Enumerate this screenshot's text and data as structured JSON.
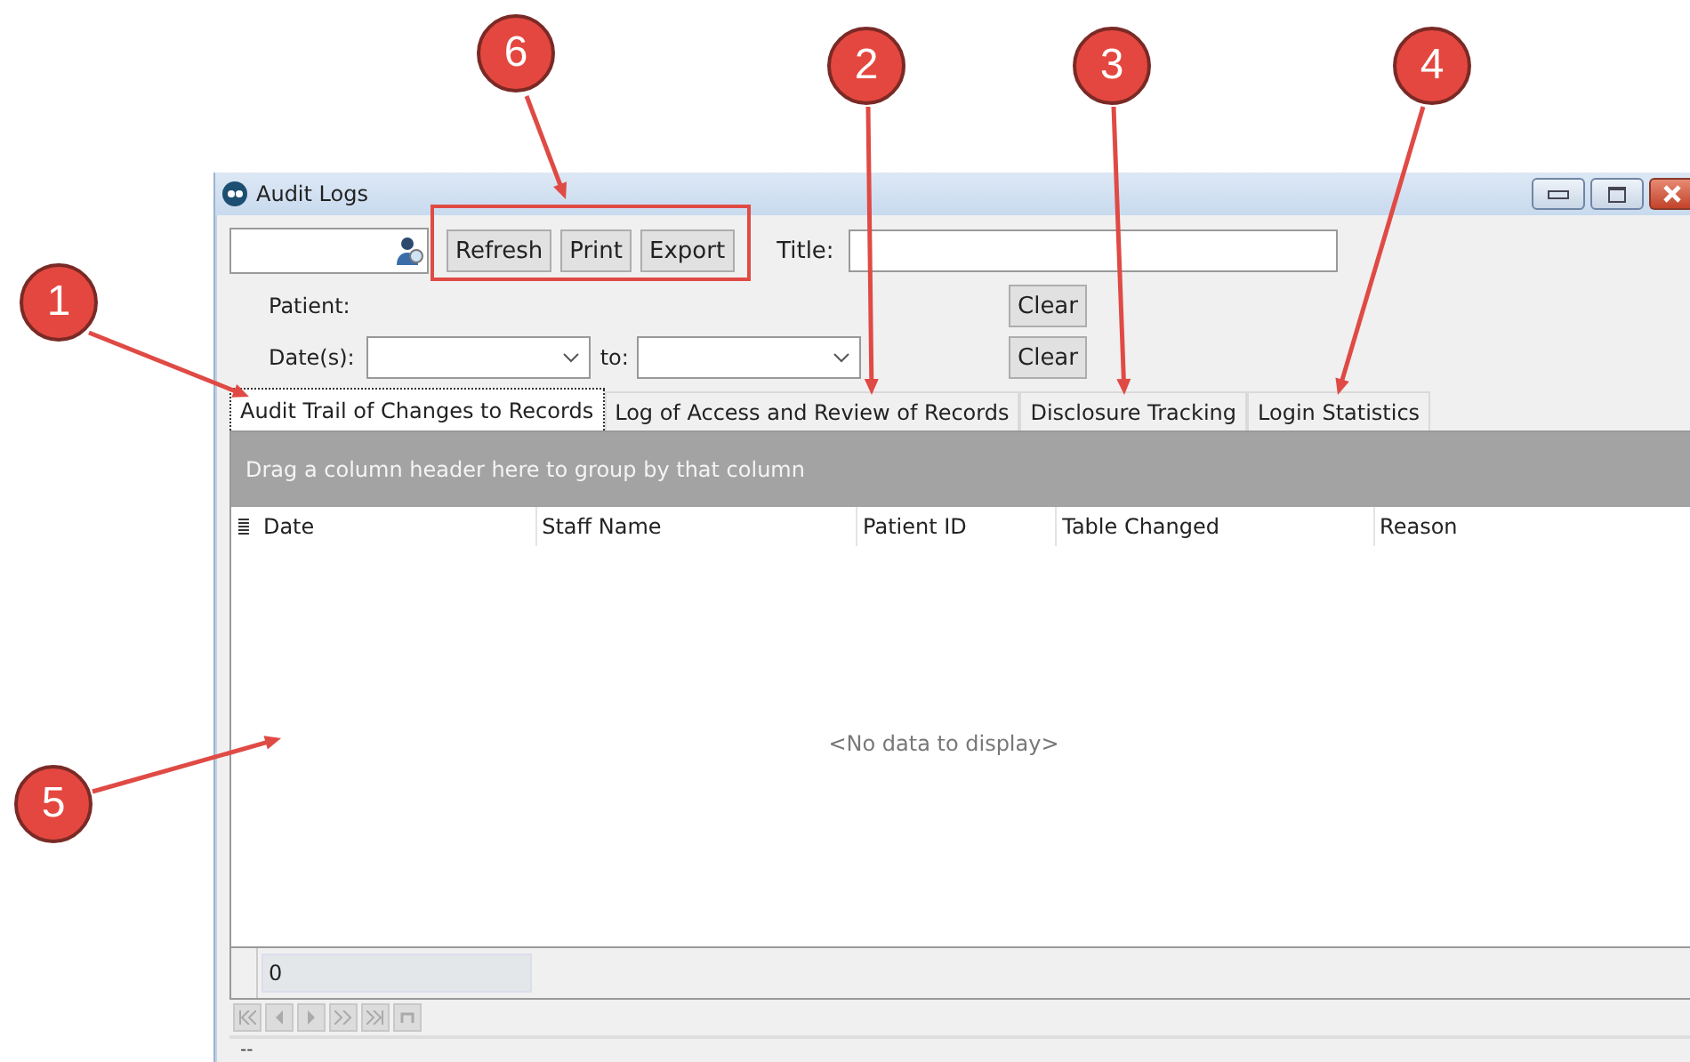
{
  "window": {
    "title": "Audit Logs"
  },
  "toolbar": {
    "buttons": [
      "Refresh",
      "Print",
      "Export"
    ],
    "title_label": "Title:"
  },
  "filters": {
    "patient_label": "Patient:",
    "dates_label": "Date(s):",
    "to_label": "to:",
    "clear_buttons": [
      "Clear",
      "Clear"
    ]
  },
  "tabs": [
    {
      "label": "Audit Trail of Changes to Records",
      "selected": true
    },
    {
      "label": "Log of Access and Review of Records",
      "selected": false
    },
    {
      "label": "Disclosure Tracking",
      "selected": false
    },
    {
      "label": "Login Statistics",
      "selected": false
    }
  ],
  "grid": {
    "group_panel": "Drag a column header here to group by that column",
    "columns": [
      "Date",
      "Staff Name",
      "Patient ID",
      "Table Changed",
      "Reason"
    ],
    "empty_message": "<No data to display>",
    "footer_count": "0"
  },
  "status_bar": "--",
  "callouts": [
    "1",
    "2",
    "3",
    "4",
    "5",
    "6"
  ]
}
